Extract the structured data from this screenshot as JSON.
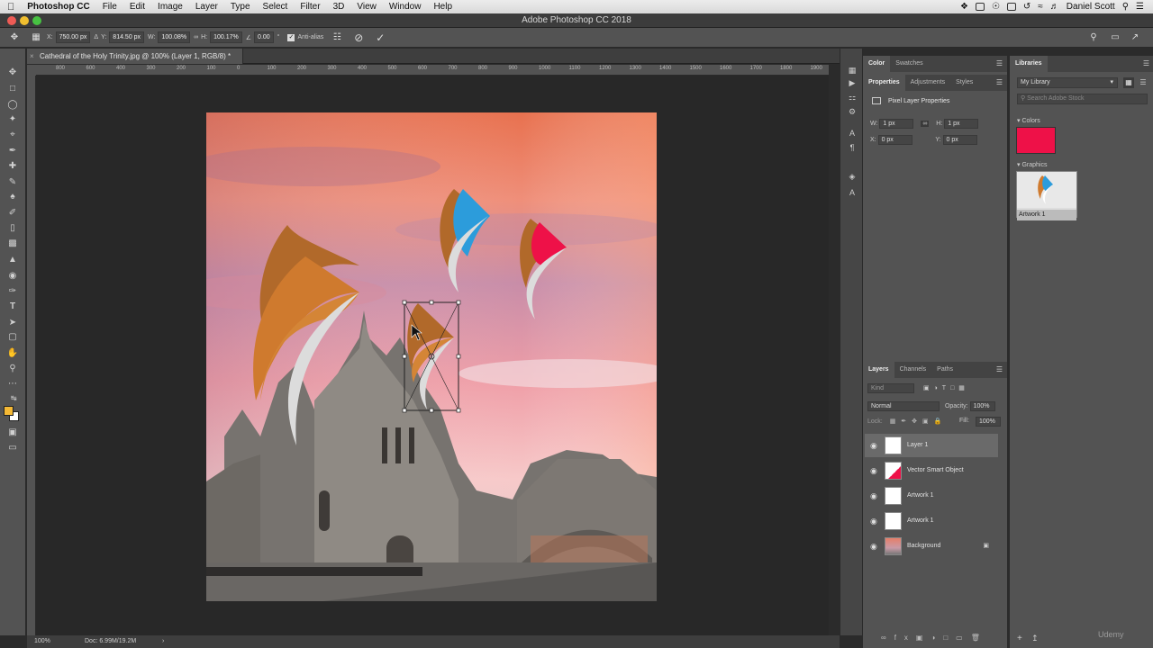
{
  "menubar": {
    "app_name": "Photoshop CC",
    "items": [
      "File",
      "Edit",
      "Image",
      "Layer",
      "Type",
      "Select",
      "Filter",
      "3D",
      "View",
      "Window",
      "Help"
    ],
    "user": "Daniel Scott"
  },
  "window": {
    "title": "Adobe Photoshop CC 2018"
  },
  "options": {
    "x_label": "X:",
    "x_value": "750.00 px",
    "y_label": "Y:",
    "y_value": "814.50 px",
    "w_label": "W:",
    "w_value": "100.08%",
    "h_label": "H:",
    "h_value": "100.17%",
    "angle_value": "0.00",
    "antialias_label": "Anti-alias"
  },
  "document": {
    "tab_title": "Cathedral of the Holy Trinity.jpg @ 100% (Layer 1, RGB/8) *",
    "ruler_ticks": [
      "800",
      "600",
      "400",
      "300",
      "200",
      "100",
      "0",
      "100",
      "200",
      "300",
      "400",
      "500",
      "600",
      "700",
      "800",
      "900",
      "1000",
      "1100",
      "1200",
      "1300",
      "1400",
      "1500",
      "1600",
      "1700",
      "1800",
      "1900",
      "2000"
    ],
    "zoom": "100%",
    "doc_size": "Doc: 6.99M/19.2M"
  },
  "color_panel": {
    "tabs": [
      "Color",
      "Swatches"
    ]
  },
  "properties_panel": {
    "tabs": [
      "Properties",
      "Adjustments",
      "Styles"
    ],
    "heading": "Pixel Layer Properties",
    "w_label": "W:",
    "w_value": "1 px",
    "h_label": "H:",
    "h_value": "1 px",
    "x_label": "X:",
    "x_value": "0 px",
    "y_label": "Y:",
    "y_value": "0 px"
  },
  "layers_panel": {
    "tabs": [
      "Layers",
      "Channels",
      "Paths"
    ],
    "blend_mode": "Normal",
    "opacity_label": "Opacity:",
    "opacity_value": "100%",
    "lock_label": "Lock:",
    "fill_label": "Fill:",
    "fill_value": "100%",
    "filter_placeholder": "Kind",
    "layers": [
      {
        "name": "Layer 1",
        "selected": true
      },
      {
        "name": "Vector Smart Object",
        "selected": false
      },
      {
        "name": "Artwork 1",
        "selected": false
      },
      {
        "name": "Artwork 1",
        "selected": false
      },
      {
        "name": "Background",
        "selected": false
      }
    ]
  },
  "libraries_panel": {
    "title": "Libraries",
    "library": "My Library",
    "search_placeholder": "Search Adobe Stock",
    "colors_label": "Colors",
    "color_swatch": "#ee1148",
    "graphics_label": "Graphics",
    "graphic_name": "Artwork 1"
  },
  "colors": {
    "foreground": "#f5b935",
    "background": "#ffffff",
    "accent_blue": "#2c9cdb",
    "accent_red": "#ee1148",
    "accent_orange": "#cf7a2e"
  },
  "watermark": "Udemy"
}
